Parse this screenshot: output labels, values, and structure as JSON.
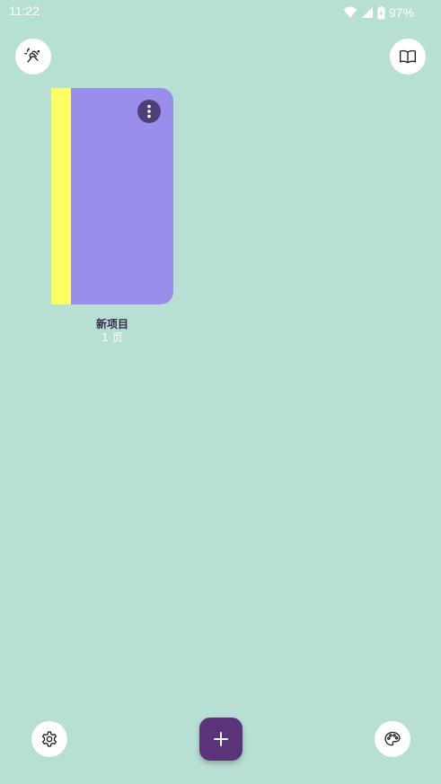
{
  "status_bar": {
    "time": "11:22",
    "battery_percent": "97%",
    "icons": [
      "wifi-icon",
      "cellular-signal-icon",
      "battery-icon"
    ]
  },
  "top_bar": {
    "left_button_icon": "magic-wand-icon",
    "right_button_icon": "book-open-icon"
  },
  "notebooks": [
    {
      "title": "新项目",
      "pages": "1 页",
      "cover_color": "#9a8eec",
      "spine_color": "#fdff62",
      "menu_icon": "more-vertical-icon"
    }
  ],
  "bottom_bar": {
    "settings_icon": "gear-icon",
    "add_icon": "plus-icon",
    "palette_icon": "palette-icon"
  },
  "colors": {
    "background": "#b8dfd3",
    "fab": "#5b3378",
    "button": "#ffffff"
  }
}
